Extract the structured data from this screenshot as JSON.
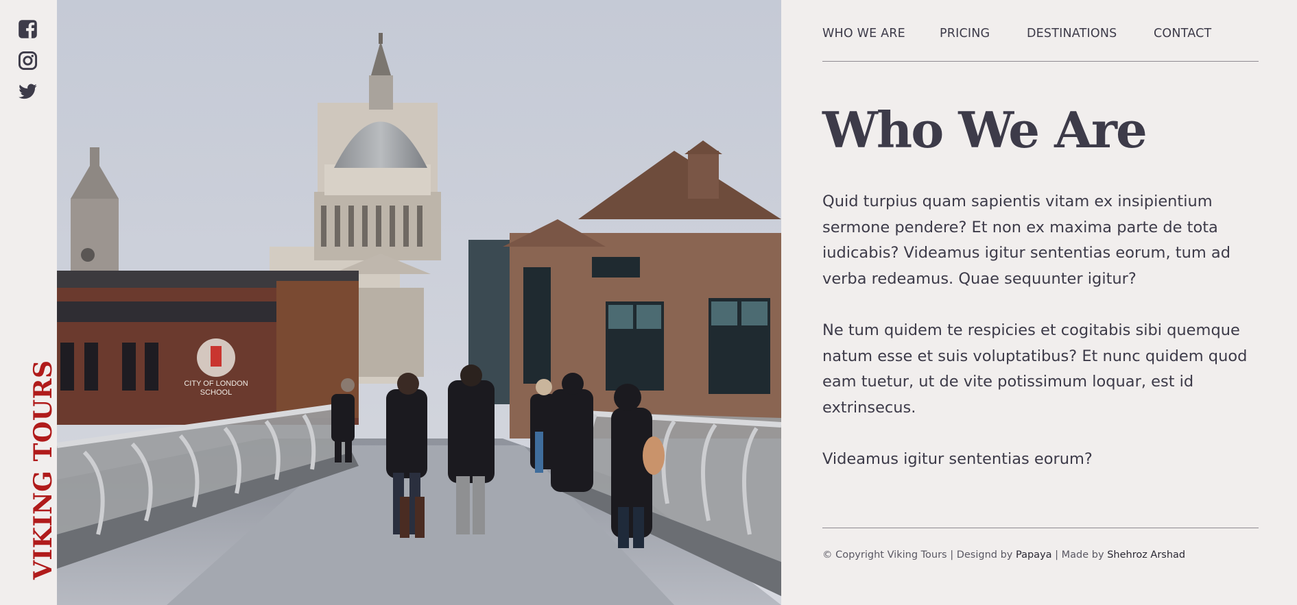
{
  "social": [
    {
      "icon": "facebook-icon"
    },
    {
      "icon": "instagram-icon"
    },
    {
      "icon": "twitter-icon"
    }
  ],
  "brand": {
    "name": "VIKING TOURS",
    "color": "#b01b1b"
  },
  "nav": {
    "items": [
      {
        "label": "WHO WE ARE"
      },
      {
        "label": "PRICING"
      },
      {
        "label": "DESTINATIONS"
      },
      {
        "label": "CONTACT"
      }
    ]
  },
  "main": {
    "title": "Who We Are",
    "paragraphs": [
      "Quid turpius quam sapientis vitam ex insipientium sermone pendere? Et non ex maxima parte de tota iudicabis? Videamus igitur sententias eorum, tum ad verba redeamus. Quae sequunter igitur?",
      "Ne tum quidem te respicies et cogitabis sibi quemque natum esse et suis voluptatibus? Et nunc quidem quod eam tuetur, ut de vite potissimum loquar, est id extrinsecus.",
      "Videamus igitur sententias eorum?"
    ]
  },
  "footer": {
    "copyright": "© Copyright Viking Tours",
    "sep1": " | ",
    "designed_prefix": "Designd by ",
    "designer": "Papaya",
    "sep2": " | ",
    "made_prefix": "Made by ",
    "maker": "Shehroz Arshad"
  },
  "photo": {
    "sign_line1": "CITY OF LONDON",
    "sign_line2": "SCHOOL"
  },
  "colors": {
    "background": "#f1eeed",
    "text": "#3d3b49",
    "brand": "#b01b1b",
    "divider": "#8e8a91"
  }
}
